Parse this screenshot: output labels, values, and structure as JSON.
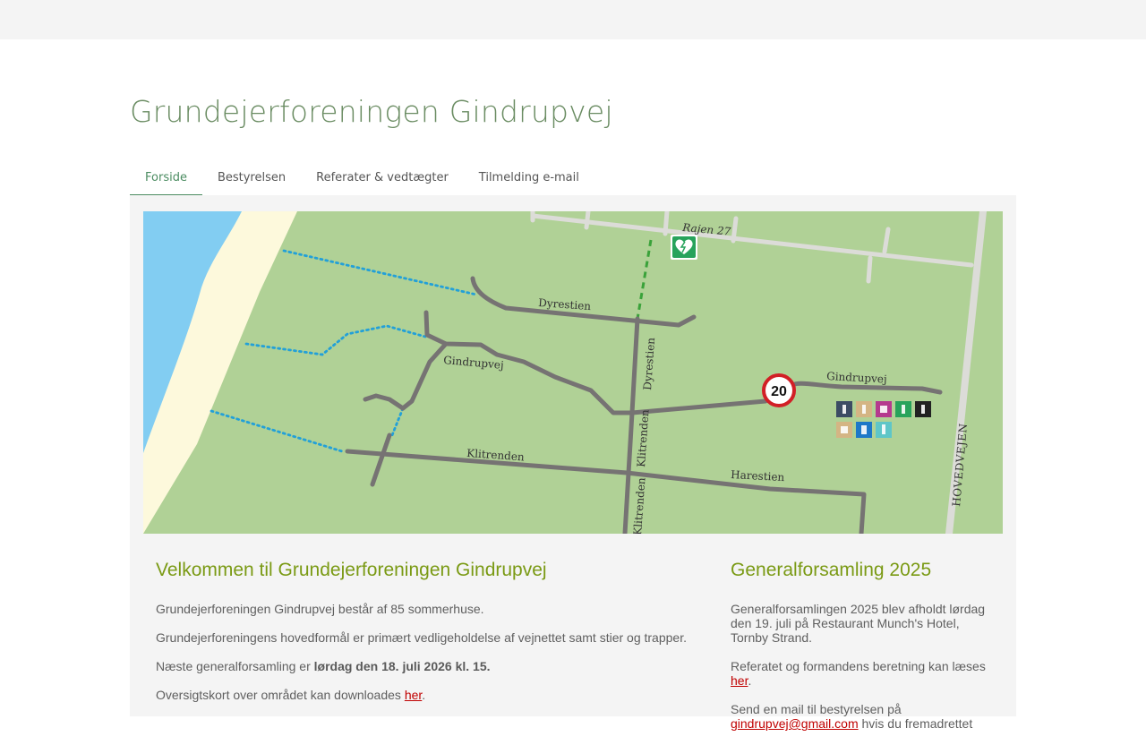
{
  "site": {
    "title": "Grundejerforeningen Gindrupvej"
  },
  "nav": {
    "items": [
      {
        "label": "Forside",
        "active": true
      },
      {
        "label": "Bestyrelsen"
      },
      {
        "label": "Referater & vedtægter"
      },
      {
        "label": "Tilmelding e-mail"
      }
    ]
  },
  "map": {
    "labels": {
      "rajen": "Rajen 27",
      "dyrestien_h": "Dyrestien",
      "dyrestien_v": "Dyrestien",
      "gindrupvej_w": "Gindrupvej",
      "gindrupvej_e": "Gindrupvej",
      "klitrenden_h": "Klitrenden",
      "klitrenden_v1": "Klitrenden",
      "klitrenden_v2": "Klitrenden",
      "harestien": "Harestien",
      "hovedvejen": "HOVEDVEJEN",
      "speed_limit": "20"
    },
    "icons": {
      "defibrillator": "defibrillator-heart-icon",
      "recycling": "recycling-station-icons"
    },
    "colors": {
      "land": "#b0d196",
      "sea": "#82cdf2",
      "beach": "#fdf9dc",
      "road": "#767373",
      "trail": "#22a0d8",
      "green_path": "#3aa23a",
      "speed_ring": "#d21f26",
      "aed": "#27a35b"
    }
  },
  "welcome": {
    "heading": "Velkommen til Grundejerforeningen Gindrupvej",
    "p1": "Grundejerforeningen Gindrupvej består af 85 sommerhuse.",
    "p2": "Grundejerforeningens hovedformål er primært vedligeholdelse af vejnettet samt stier og trapper.",
    "p3_prefix": "Næste generalforsamling er ",
    "p3_bold": "lørdag den 18. juli 2026 kl. 15.",
    "p4_prefix": "Oversigtskort over området kan downloades ",
    "p4_link": "her",
    "p4_suffix": "."
  },
  "general_assembly": {
    "heading": "Generalforsamling 2025",
    "p1": "Generalforsamlingen 2025 blev afholdt lørdag den 19. juli på Restaurant Munch's Hotel, Tornby Strand.",
    "p2_prefix": "Referatet og formandens beretning kan læses ",
    "p2_link": "her",
    "p2_suffix": ".",
    "p3_prefix": "Send en mail til bestyrelsen på ",
    "p3_link": "gindrupvej@gmail.com",
    "p3_suffix": " hvis du fremadrettet"
  }
}
